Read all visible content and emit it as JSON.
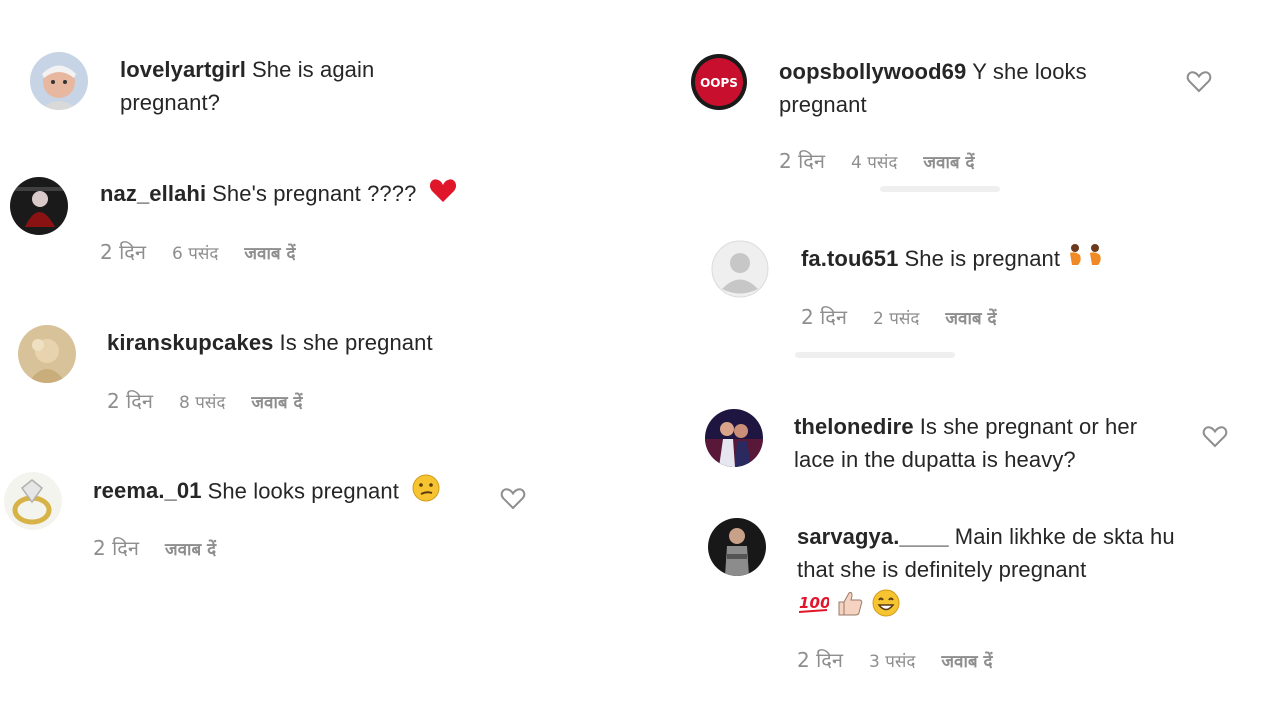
{
  "comments": [
    {
      "username": "lovelyartgirl",
      "text": "She is again pregnant?"
    },
    {
      "username": "naz_ellahi",
      "text": "She's pregnant ????",
      "time": "2 दिन",
      "likes": "6 पसंद",
      "reply": "जवाब दें"
    },
    {
      "username": "kiranskupcakes",
      "text": "Is she pregnant",
      "time": "2 दिन",
      "likes": "8 पसंद",
      "reply": "जवाब दें"
    },
    {
      "username": "reema._01",
      "text": "She looks pregnant",
      "time": "2 दिन",
      "reply": "जवाब दें"
    },
    {
      "username": "oopsbollywood69",
      "text": "Y she looks pregnant",
      "time": "2 दिन",
      "likes": "4 पसंद",
      "reply": "जवाब दें",
      "avatar_label": "OOPS"
    },
    {
      "username": "fa.tou651",
      "text": "She is pregnant",
      "time": "2 दिन",
      "likes": "2 पसंद",
      "reply": "जवाब दें"
    },
    {
      "username": "thelonedire",
      "text": "Is she pregnant or her lace in the dupatta is heavy?"
    },
    {
      "username": "sarvagya.____",
      "text": "Main likhke de skta hu that she is definitely pregnant",
      "time": "2 दिन",
      "likes": "3 पसंद",
      "reply": "जवाब दें"
    }
  ],
  "colors": {
    "text": "#262626",
    "meta": "#8e8e8e",
    "heart": "#ed4956",
    "oops_red": "#c8102e"
  }
}
